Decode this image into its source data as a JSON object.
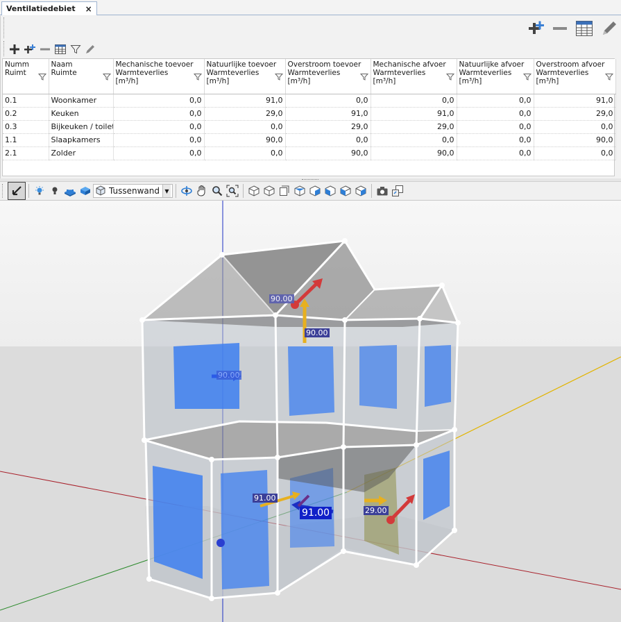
{
  "tab": {
    "title": "Ventilatiedebiet",
    "close_glyph": "×"
  },
  "toolbar": {
    "add_icon": "plus-icon",
    "add_multi_icon": "add-multiple-icon",
    "remove_icon": "minus-icon",
    "table_icon": "table-icon",
    "filter_icon": "filter-icon",
    "edit_icon": "pencil-icon"
  },
  "table": {
    "columns": [
      {
        "label": "Numm\nRuimt"
      },
      {
        "label": "Naam\nRuimte"
      },
      {
        "label": "Mechanische toevoer\nWarmteverlies\n[m³/h]"
      },
      {
        "label": "Natuurlijke toevoer\nWarmteverlies\n[m³/h]"
      },
      {
        "label": "Overstroom toevoer\nWarmteverlies\n[m³/h]"
      },
      {
        "label": "Mechanische afvoer\nWarmteverlies\n[m³/h]"
      },
      {
        "label": "Natuurlijke afvoer\nWarmteverlies\n[m³/h]"
      },
      {
        "label": "Overstroom afvoer\nWarmteverlies\n[m³/h]"
      }
    ],
    "rows": [
      [
        "0.1",
        "Woonkamer",
        "0,0",
        "91,0",
        "0,0",
        "0,0",
        "0,0",
        "91,0"
      ],
      [
        "0.2",
        "Keuken",
        "0,0",
        "29,0",
        "91,0",
        "91,0",
        "0,0",
        "29,0"
      ],
      [
        "0.3",
        "Bijkeuken / toilet",
        "0,0",
        "0,0",
        "29,0",
        "29,0",
        "0,0",
        "0,0"
      ],
      [
        "1.1",
        "Slaapkamers",
        "0,0",
        "90,0",
        "0,0",
        "0,0",
        "0,0",
        "90,0"
      ],
      [
        "2.1",
        "Zolder",
        "0,0",
        "0,0",
        "90,0",
        "90,0",
        "0,0",
        "0,0"
      ]
    ]
  },
  "view_toolbar": {
    "layer_select": "Tussenwand",
    "icons": [
      "select-arrow-icon",
      "light-icon",
      "bulb-icon",
      "blocks-icon",
      "cube-blue-icon",
      "cube-layer-icon",
      "orbit-icon",
      "pan-hand-icon",
      "zoom-icon",
      "zoom-extents-icon",
      "view-iso-icon",
      "view-top-icon",
      "view-front-icon",
      "view-back-icon",
      "view-left-icon",
      "view-right-icon",
      "view-bottom-icon",
      "view-perspective-icon",
      "screenshot-icon",
      "export-icon"
    ]
  },
  "viewport": {
    "labels": {
      "attic_top": "90.00",
      "attic_floor": "90.00",
      "bedroom_arrow": "90.00",
      "living_small": "91.00",
      "living_big": "91.00",
      "kitchen": "29.00"
    },
    "colors": {
      "axis_red": "#b3262d",
      "axis_green": "#2c8a2c",
      "axis_blue": "#1c2fc4",
      "axis_yellow": "#e2b400",
      "window_blue": "#3d7ff0",
      "arrow_red": "#d33a3a",
      "arrow_yellow": "#e7b020",
      "label_bg": "#3b3f98"
    }
  }
}
